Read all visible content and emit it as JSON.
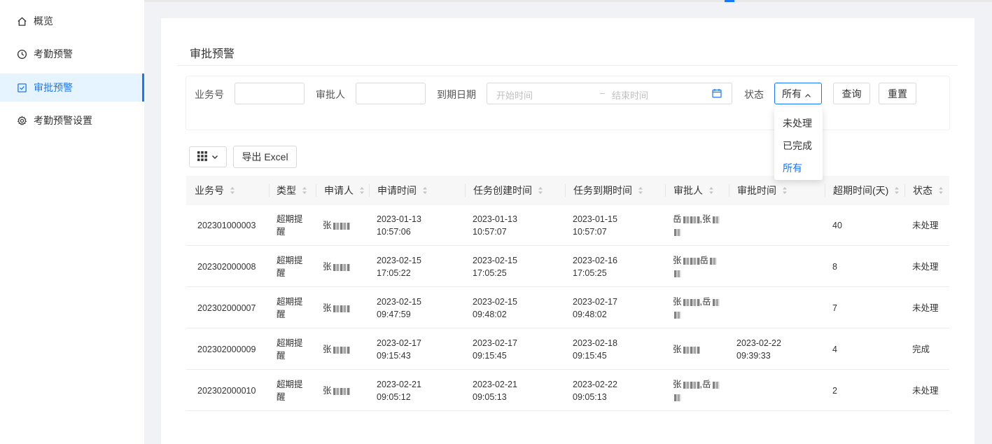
{
  "sidebar": {
    "items": [
      {
        "label": "概览",
        "icon": "home-icon"
      },
      {
        "label": "考勤预警",
        "icon": "clock-icon"
      },
      {
        "label": "审批预警",
        "icon": "checkbox-icon",
        "active": true
      },
      {
        "label": "考勤预警设置",
        "icon": "gear-icon"
      }
    ]
  },
  "page": {
    "title": "审批预警"
  },
  "filters": {
    "business_no_label": "业务号",
    "approver_label": "审批人",
    "due_date_label": "到期日期",
    "start_placeholder": "开始时间",
    "range_separator": "–",
    "end_placeholder": "结束时间",
    "status_label": "状态",
    "status_value": "所有",
    "status_options": [
      "未处理",
      "已完成",
      "所有"
    ],
    "query_button": "查询",
    "reset_button": "重置"
  },
  "toolbar": {
    "export_label": "导出 Excel"
  },
  "table": {
    "headers": [
      "业务号",
      "类型",
      "申请人",
      "申请时间",
      "任务创建时间",
      "任务到期时间",
      "审批人",
      "审批时间",
      "超期时间(天)",
      "状态"
    ],
    "rows": [
      {
        "no": "202301000003",
        "type1": "超期提",
        "type2": "醒",
        "applicant": "张",
        "apply_date": "2023-01-13",
        "apply_time": "10:57:06",
        "create_date": "2023-01-13",
        "create_time": "10:57:07",
        "due_date": "2023-01-15",
        "due_time": "10:57:07",
        "approver1": "岳",
        "approver2": ",张",
        "approve_date": "",
        "approve_time": "",
        "overdue": "40",
        "status": "未处理"
      },
      {
        "no": "202302000008",
        "type1": "超期提",
        "type2": "醒",
        "applicant": "张",
        "apply_date": "2023-02-15",
        "apply_time": "17:05:22",
        "create_date": "2023-02-15",
        "create_time": "17:05:25",
        "due_date": "2023-02-16",
        "due_time": "17:05:25",
        "approver1": "张",
        "approver2": "岳",
        "approve_date": "",
        "approve_time": "",
        "overdue": "8",
        "status": "未处理"
      },
      {
        "no": "202302000007",
        "type1": "超期提",
        "type2": "醒",
        "applicant": "张",
        "apply_date": "2023-02-15",
        "apply_time": "09:47:59",
        "create_date": "2023-02-15",
        "create_time": "09:48:02",
        "due_date": "2023-02-17",
        "due_time": "09:48:02",
        "approver1": "张",
        "approver2": ",岳",
        "approve_date": "",
        "approve_time": "",
        "overdue": "7",
        "status": "未处理"
      },
      {
        "no": "202302000009",
        "type1": "超期提",
        "type2": "醒",
        "applicant": "张",
        "apply_date": "2023-02-17",
        "apply_time": "09:15:43",
        "create_date": "2023-02-17",
        "create_time": "09:15:45",
        "due_date": "2023-02-18",
        "due_time": "09:15:45",
        "approver1": "张",
        "approver2": "",
        "approve_date": "2023-02-22",
        "approve_time": "09:39:33",
        "overdue": "4",
        "status": "完成"
      },
      {
        "no": "202302000010",
        "type1": "超期提",
        "type2": "醒",
        "applicant": "张",
        "apply_date": "2023-02-21",
        "apply_time": "09:05:12",
        "create_date": "2023-02-21",
        "create_time": "09:05:13",
        "due_date": "2023-02-22",
        "due_time": "09:05:13",
        "approver1": "张",
        "approver2": ",岳",
        "approve_date": "",
        "approve_time": "",
        "overdue": "2",
        "status": "未处理"
      }
    ]
  },
  "colors": {
    "accent": "#1677ff",
    "active_bg": "#e6f4ff",
    "header_bg": "#f7f7f7"
  }
}
